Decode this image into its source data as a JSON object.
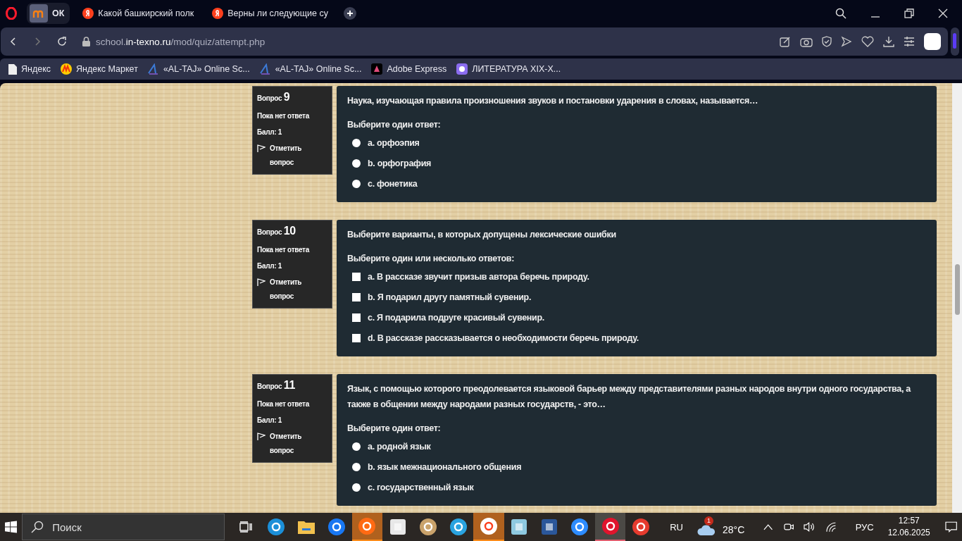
{
  "browser": {
    "tabs": [
      {
        "kind": "moodle",
        "label": "ОК",
        "selected": true
      },
      {
        "kind": "yandex",
        "label": "Какой башкирский полк",
        "selected": false
      },
      {
        "kind": "yandex",
        "label": "Верны ли следующие су",
        "selected": false
      }
    ],
    "address": {
      "prefix": "school.",
      "domain": "in-texno.ru",
      "path": "/mod/quiz/attempt.php"
    },
    "bookmarks": [
      {
        "kind": "page",
        "label": "Яндекс"
      },
      {
        "kind": "market",
        "label": "Яндекс Маркет"
      },
      {
        "kind": "altaj",
        "label": "«AL-TAJ» Online Sc..."
      },
      {
        "kind": "altaj",
        "label": "«AL-TAJ» Online Sc..."
      },
      {
        "kind": "adobe",
        "label": "Adobe Express"
      },
      {
        "kind": "lit",
        "label": "ЛИТЕРАТУРА XIX-X..."
      }
    ]
  },
  "questions": [
    {
      "label": "Вопрос",
      "number": "9",
      "status": "Пока нет ответа",
      "grade": "Балл: 1",
      "flag": "Отметить вопрос",
      "prompt": "Наука, изучающая правила произношения звуков и постановки ударения в словах, называется…",
      "instruction": "Выберите один ответ:",
      "kind": "radio",
      "options": [
        {
          "label": "a. орфоэпия",
          "selected": false
        },
        {
          "label": "b. орфография",
          "selected": false
        },
        {
          "label": "c. фонетика",
          "selected": false
        }
      ]
    },
    {
      "label": "Вопрос",
      "number": "10",
      "status": "Пока нет ответа",
      "grade": "Балл: 1",
      "flag": "Отметить вопрос",
      "prompt": "Выберите варианты, в которых допущены лексические ошибки",
      "instruction": "Выберите один или несколько ответов:",
      "kind": "checkbox",
      "options": [
        {
          "label": "a. В рассказе звучит призыв автора беречь природу.",
          "selected": false
        },
        {
          "label": "b. Я подарил другу памятный сувенир.",
          "selected": false
        },
        {
          "label": "c. Я подарила подруге красивый сувенир.",
          "selected": false
        },
        {
          "label": "d. В рассказе рассказывается о необходимости беречь природу.",
          "selected": false
        }
      ]
    },
    {
      "label": "Вопрос",
      "number": "11",
      "status": "Пока нет ответа",
      "grade": "Балл: 1",
      "flag": "Отметить вопрос",
      "prompt": "Язык, с помощью которого преодолевается языковой барьер между представителями разных народов внутри одного государства, а также в общении между народами разных государств, - это…",
      "instruction": "Выберите один ответ:",
      "kind": "radio",
      "options": [
        {
          "label": "a. родной язык",
          "selected": false
        },
        {
          "label": "b. язык межнационального общения",
          "selected": false
        },
        {
          "label": "c. государственный язык",
          "selected": false
        }
      ]
    }
  ],
  "taskbar": {
    "search_placeholder": "Поиск",
    "apps": [
      {
        "kind": "taskview",
        "flashing": false,
        "focused": false
      },
      {
        "kind": "edge",
        "flashing": false,
        "focused": false
      },
      {
        "kind": "folder",
        "flashing": false,
        "focused": false
      },
      {
        "kind": "facebook",
        "flashing": false,
        "focused": false
      },
      {
        "kind": "play",
        "flashing": true,
        "focused": false
      },
      {
        "kind": "store",
        "flashing": false,
        "focused": false
      },
      {
        "kind": "paint",
        "flashing": false,
        "focused": false
      },
      {
        "kind": "telegram",
        "flashing": false,
        "focused": false
      },
      {
        "kind": "yandex",
        "flashing": true,
        "focused": false
      },
      {
        "kind": "notepad",
        "flashing": false,
        "focused": false
      },
      {
        "kind": "word",
        "flashing": false,
        "focused": false
      },
      {
        "kind": "zoom",
        "flashing": false,
        "focused": false
      },
      {
        "kind": "opera",
        "flashing": false,
        "focused": true
      },
      {
        "kind": "wps",
        "flashing": false,
        "focused": false
      }
    ],
    "language": "RU",
    "weather_badge": "1",
    "temperature": "28°C",
    "input_language": "РУС",
    "time": "12:57",
    "date": "12.06.2025"
  }
}
